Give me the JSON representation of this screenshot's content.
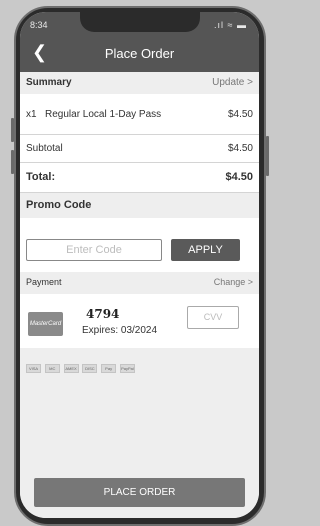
{
  "status": {
    "time": "8:34",
    "signal": ".ıl ≈ ▬"
  },
  "header": {
    "title": "Place Order"
  },
  "summary": {
    "heading": "Summary",
    "action": "Update >"
  },
  "order_items": [
    {
      "qty": "x1",
      "name": "Regular Local 1-Day Pass",
      "price": "$4.50"
    }
  ],
  "subtotal": {
    "label": "Subtotal",
    "value": "$4.50"
  },
  "total": {
    "label": "Total:",
    "value": "$4.50"
  },
  "promo": {
    "heading": "Promo Code",
    "placeholder": "Enter Code",
    "apply_label": "APPLY"
  },
  "payment": {
    "heading": "Payment",
    "action": "Change >",
    "card_brand": "MasterCard",
    "last4": "4794",
    "expires": "Expires: 03/2024",
    "cvv_placeholder": "CVV"
  },
  "accepted_brands": [
    "VISA",
    "MC",
    "AMEX",
    "DISC",
    "Pay",
    "PayPal"
  ],
  "place_order_label": "PLACE ORDER",
  "colors": {
    "header": "#555555",
    "button": "#5a5a5a",
    "place_order": "#777777",
    "section_bg": "#eeeeee"
  }
}
